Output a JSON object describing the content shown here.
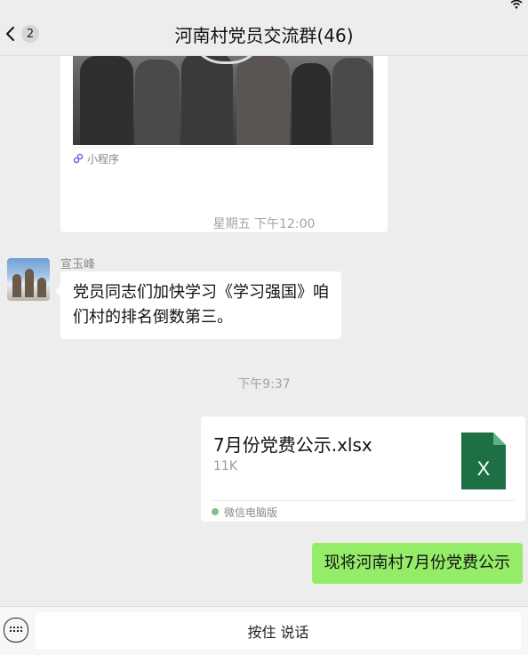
{
  "header": {
    "back_count": "2",
    "title": "河南村党员交流群(46)"
  },
  "chat": {
    "mini_program_label": "小程序",
    "time_1": "星期五 下午12:00",
    "message_1": {
      "sender": "宣玉峰",
      "text_line_1": "党员同志们加快学习《学习强国》咱",
      "text_line_2": "们村的排名倒数第三。"
    },
    "time_2": "下午9:37",
    "file": {
      "name": "7月份党费公示.xlsx",
      "size": "11K",
      "icon_letter": "X",
      "source": "微信电脑版"
    },
    "message_2": {
      "text": "现将河南村7月份党费公示"
    }
  },
  "input": {
    "hold_to_talk": "按住 说话"
  },
  "colors": {
    "background": "#ededed",
    "own_bubble": "#95ec69",
    "excel_green": "#1d7044"
  },
  "icons": [
    "wifi-icon",
    "back-chevron-icon",
    "mini-program-icon",
    "excel-file-icon",
    "wechat-pc-icon",
    "keyboard-icon"
  ]
}
